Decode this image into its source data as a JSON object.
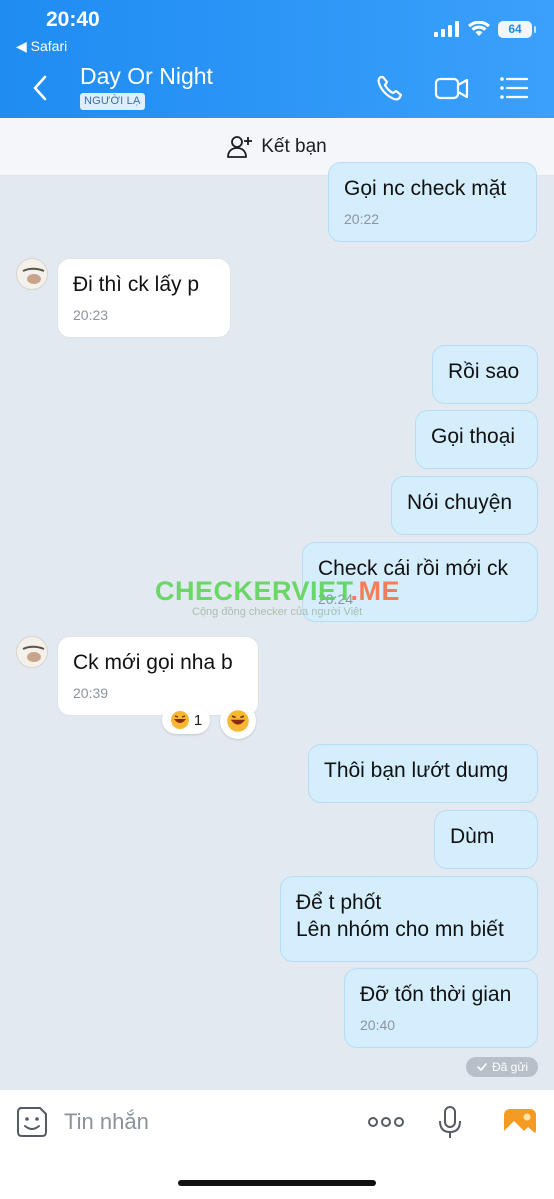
{
  "status_bar": {
    "time": "20:40",
    "back_app": "◀ Safari",
    "battery": "64"
  },
  "header": {
    "title": "Day Or Night",
    "tag": "NGƯỜI LẠ"
  },
  "add_friend": {
    "label": "Kết bạn"
  },
  "messages": [
    {
      "dir": "out",
      "text": "Gọi nc check mặt",
      "time": "20:22"
    },
    {
      "dir": "in",
      "text": "Đi thì ck lấy p",
      "time": "20:23"
    },
    {
      "dir": "out",
      "text": "Rồi sao",
      "time": ""
    },
    {
      "dir": "out",
      "text": "Gọi thoại",
      "time": ""
    },
    {
      "dir": "out",
      "text": "Nói chuyện",
      "time": ""
    },
    {
      "dir": "out",
      "text": "Check cái rồi mới ck",
      "time": "20:24"
    },
    {
      "dir": "in",
      "text": "Ck mới gọi nha b",
      "time": "20:39",
      "reaction_count": "1"
    },
    {
      "dir": "out",
      "text": "Thôi bạn lướt dumg",
      "time": ""
    },
    {
      "dir": "out",
      "text": "Dùm",
      "time": ""
    },
    {
      "dir": "out",
      "line1": "Để t phốt",
      "line2": "Lên nhóm cho mn biết",
      "time": ""
    },
    {
      "dir": "out",
      "text": "Đỡ tốn thời gian",
      "time": "20:40"
    }
  ],
  "watermark": {
    "brand": "CHECKERVIET",
    "suffix": ".ME",
    "tagline": "Cộng đồng checker của người Việt"
  },
  "sent_status": "Đã gửi",
  "composer": {
    "placeholder": "Tin nhắn"
  },
  "colors": {
    "header_start": "#1f8cf2",
    "header_end": "#3aa0fb",
    "outgoing_bubble": "#d4eefe",
    "incoming_bubble": "#ffffff",
    "chat_bg": "#e2e9f1",
    "watermark_green": "#57d44e",
    "watermark_orange": "#ff6a3a"
  },
  "icons": [
    "chevron-left-icon",
    "phone-icon",
    "video-call-icon",
    "menu-list-icon",
    "add-user-icon",
    "emoji-sticker-icon",
    "more-dots-icon",
    "microphone-icon",
    "image-gallery-icon",
    "laugh-emoji-icon",
    "check-icon"
  ]
}
